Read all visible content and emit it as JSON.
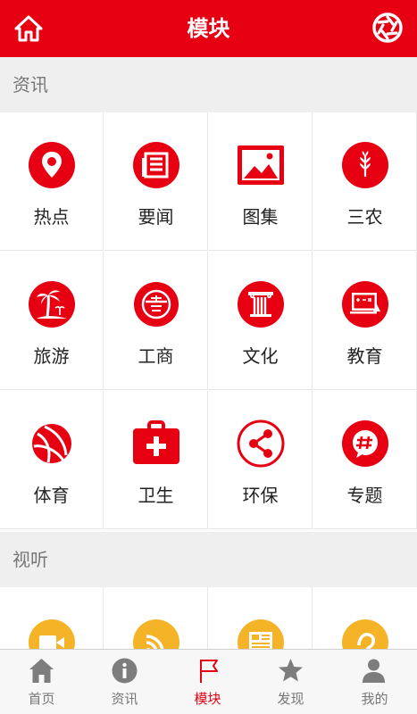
{
  "header": {
    "title": "模块"
  },
  "sections": [
    {
      "label": "资讯",
      "items": [
        {
          "label": "热点",
          "icon": "location-pin-icon"
        },
        {
          "label": "要闻",
          "icon": "newspaper-icon"
        },
        {
          "label": "图集",
          "icon": "picture-icon"
        },
        {
          "label": "三农",
          "icon": "wheat-icon"
        },
        {
          "label": "旅游",
          "icon": "palm-tree-icon"
        },
        {
          "label": "工商",
          "icon": "coin-icon"
        },
        {
          "label": "文化",
          "icon": "pillar-icon"
        },
        {
          "label": "教育",
          "icon": "blackboard-icon"
        },
        {
          "label": "体育",
          "icon": "ball-icon"
        },
        {
          "label": "卫生",
          "icon": "medical-kit-icon"
        },
        {
          "label": "环保",
          "icon": "share-icon"
        },
        {
          "label": "专题",
          "icon": "hashtag-icon"
        }
      ]
    },
    {
      "label": "视听",
      "items": [
        {
          "icon": "video-camera-icon"
        },
        {
          "icon": "rss-icon"
        },
        {
          "icon": "news-card-icon"
        },
        {
          "icon": "audio-icon"
        }
      ]
    }
  ],
  "tabbar": [
    {
      "label": "首页",
      "icon": "home-icon"
    },
    {
      "label": "资讯",
      "icon": "info-icon"
    },
    {
      "label": "模块",
      "icon": "flag-icon"
    },
    {
      "label": "发现",
      "icon": "star-icon"
    },
    {
      "label": "我的",
      "icon": "user-icon"
    }
  ],
  "colors": {
    "brand": "#e60012",
    "secondary_icon": "#f5b327",
    "tab_inactive": "#7d7d7d"
  }
}
